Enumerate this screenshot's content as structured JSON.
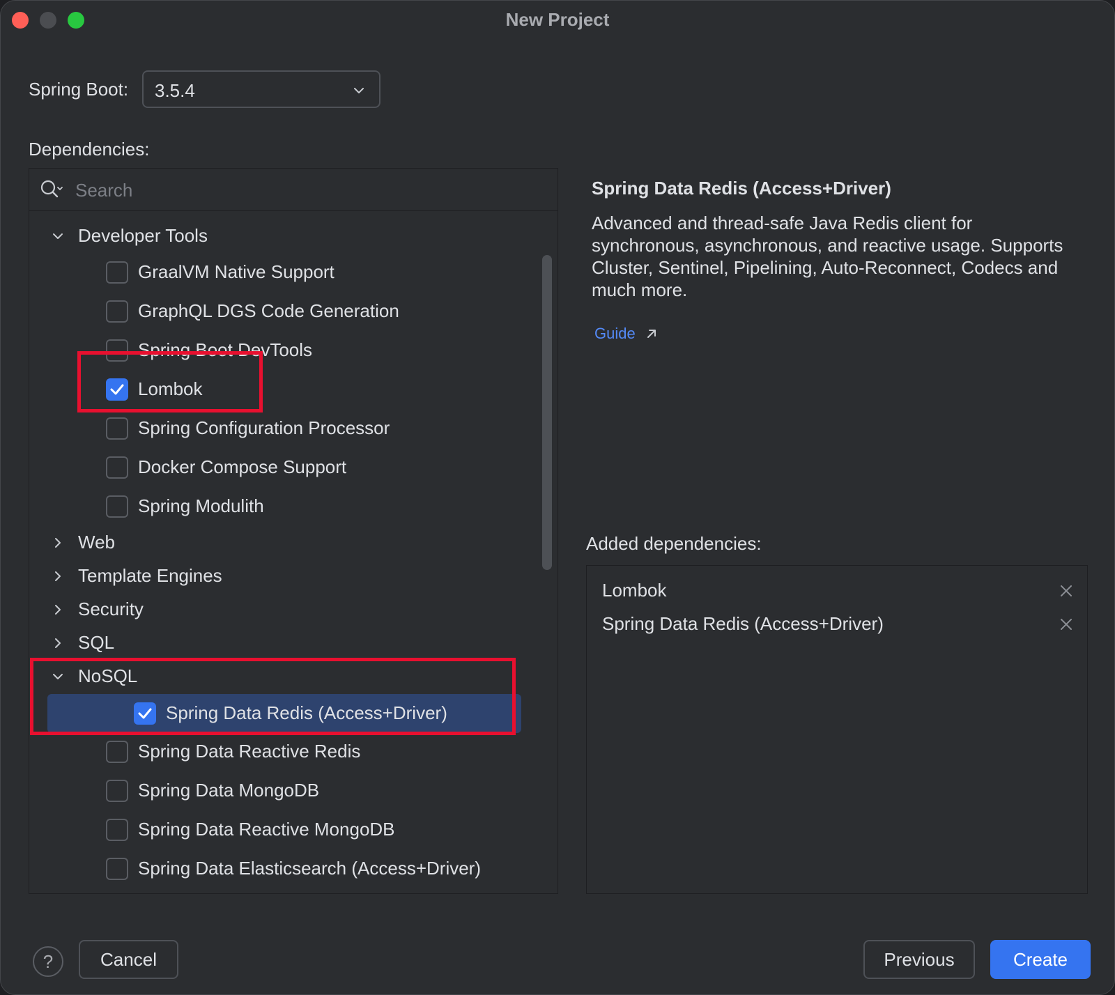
{
  "window": {
    "title": "New Project"
  },
  "spring_boot": {
    "label": "Spring Boot:",
    "selected_version": "3.5.4"
  },
  "dependencies": {
    "label": "Dependencies:",
    "search_placeholder": "Search",
    "tree": {
      "developer_tools": {
        "label": "Developer Tools",
        "expanded": true,
        "items": [
          {
            "label": "GraalVM Native Support",
            "checked": false
          },
          {
            "label": "GraphQL DGS Code Generation",
            "checked": false
          },
          {
            "label": "Spring Boot DevTools",
            "checked": false
          },
          {
            "label": "Lombok",
            "checked": true
          },
          {
            "label": "Spring Configuration Processor",
            "checked": false
          },
          {
            "label": "Docker Compose Support",
            "checked": false
          },
          {
            "label": "Spring Modulith",
            "checked": false
          }
        ]
      },
      "web": {
        "label": "Web",
        "expanded": false
      },
      "template_engines": {
        "label": "Template Engines",
        "expanded": false
      },
      "security": {
        "label": "Security",
        "expanded": false
      },
      "sql": {
        "label": "SQL",
        "expanded": false
      },
      "nosql": {
        "label": "NoSQL",
        "expanded": true,
        "items": [
          {
            "label": "Spring Data Redis (Access+Driver)",
            "checked": true,
            "selected": true
          },
          {
            "label": "Spring Data Reactive Redis",
            "checked": false
          },
          {
            "label": "Spring Data MongoDB",
            "checked": false
          },
          {
            "label": "Spring Data Reactive MongoDB",
            "checked": false
          },
          {
            "label": "Spring Data Elasticsearch (Access+Driver)",
            "checked": false
          }
        ]
      }
    }
  },
  "details": {
    "title": "Spring Data Redis (Access+Driver)",
    "description": "Advanced and thread-safe Java Redis client for synchronous, asynchronous, and reactive usage. Supports Cluster, Sentinel, Pipelining, Auto-Reconnect, Codecs and much more.",
    "guide_label": "Guide"
  },
  "added": {
    "label": "Added dependencies:",
    "items": [
      {
        "label": "Lombok"
      },
      {
        "label": "Spring Data Redis (Access+Driver)"
      }
    ]
  },
  "footer": {
    "help_label": "?",
    "cancel_label": "Cancel",
    "previous_label": "Previous",
    "create_label": "Create"
  },
  "colors": {
    "background": "#2b2d30",
    "accent": "#3574f0",
    "selection": "#2e436e",
    "link": "#548af7",
    "highlight": "#e8102f"
  },
  "icons": {
    "search": "search-icon",
    "dropdown": "chevron-down-icon",
    "expanded": "chevron-down-icon",
    "collapsed": "chevron-right-icon",
    "check": "check-icon",
    "external": "external-link-icon",
    "remove": "close-icon"
  }
}
